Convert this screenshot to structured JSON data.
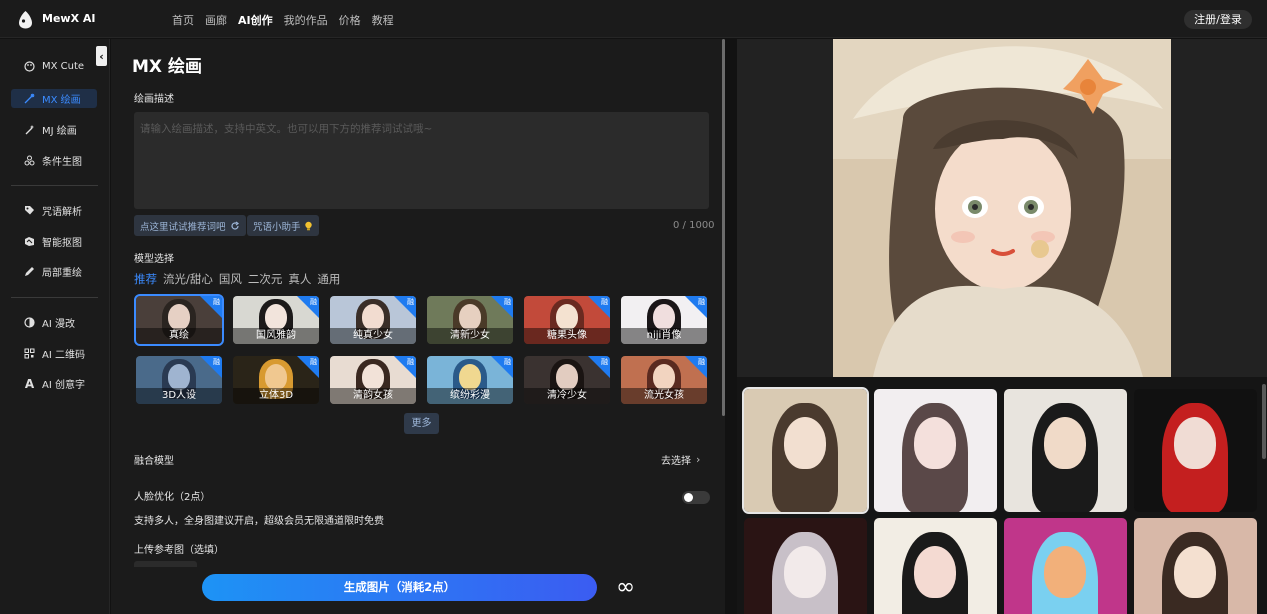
{
  "topbar": {
    "brand": "MewX AI",
    "nav": [
      "首页",
      "画廊",
      "AI创作",
      "我的作品",
      "价格",
      "教程"
    ],
    "active_nav": "AI创作",
    "login": "注册/登录"
  },
  "sidebar": {
    "items": [
      {
        "label": "MX Cute",
        "icon": "palette-icon"
      },
      {
        "label": "MX 绘画",
        "icon": "brush-icon",
        "active": true
      },
      {
        "label": "MJ 绘画",
        "icon": "wand-icon"
      },
      {
        "label": "条件生图",
        "icon": "nodes-icon"
      },
      {
        "label": "咒语解析",
        "icon": "tag-icon"
      },
      {
        "label": "智能抠图",
        "icon": "cutout-icon"
      },
      {
        "label": "局部重绘",
        "icon": "pen-icon"
      },
      {
        "label": "AI 漫改",
        "icon": "contrast-icon"
      },
      {
        "label": "AI 二维码",
        "icon": "qrcode-icon"
      },
      {
        "label": "AI 创意字",
        "icon": "letter-a-icon"
      }
    ]
  },
  "main": {
    "title": "MX 绘画",
    "desc_label": "绘画描述",
    "desc_placeholder": "请输入绘画描述，支持中英文。也可以用下方的推荐词试试哦~",
    "try_words": "点这里试试推荐词吧",
    "spell_helper": "咒语小助手",
    "counter": "0 / 1000",
    "model_label": "模型选择",
    "tabs": [
      "推荐",
      "流光/甜心",
      "国风",
      "二次元",
      "真人",
      "通用"
    ],
    "active_tab": "推荐",
    "badge": "融",
    "models": [
      {
        "label": "真绘",
        "colors": [
          "#4a3f3a",
          "#e6d0c4",
          "#2a2420"
        ]
      },
      {
        "label": "国风雅韵",
        "colors": [
          "#d8d8d2",
          "#f2e4dc",
          "#1c1a1a"
        ]
      },
      {
        "label": "纯真少女",
        "colors": [
          "#b9c6d8",
          "#f2dcd0",
          "#3a2e28"
        ]
      },
      {
        "label": "清新少女",
        "colors": [
          "#6f7a5a",
          "#e6d0c0",
          "#4a3a28"
        ]
      },
      {
        "label": "糖果头像",
        "colors": [
          "#c24a3a",
          "#f4e2d0",
          "#6a2a20"
        ]
      },
      {
        "label": "niji肖像",
        "colors": [
          "#f2f0f2",
          "#f0dede",
          "#1a1618"
        ]
      },
      {
        "label": "3D人设",
        "colors": [
          "#4a6a8a",
          "#9fb4d0",
          "#2a3a52"
        ]
      },
      {
        "label": "立体3D",
        "colors": [
          "#2a2418",
          "#f0c890",
          "#d89a30"
        ]
      },
      {
        "label": "清韵女孩",
        "colors": [
          "#e8dcd2",
          "#f2e2d8",
          "#3a2820"
        ]
      },
      {
        "label": "缤纷彩漫",
        "colors": [
          "#7ab4d8",
          "#f0d890",
          "#2a5a8a"
        ]
      },
      {
        "label": "清冷少女",
        "colors": [
          "#3a3230",
          "#e2ccc0",
          "#1a1412"
        ]
      },
      {
        "label": "流光女孩",
        "colors": [
          "#c07050",
          "#f2d4c0",
          "#5a2a20"
        ]
      }
    ],
    "more": "更多",
    "fusion_label": "融合模型",
    "fusion_action": "去选择",
    "face_label": "人脸优化（2点）",
    "face_desc": "支持多人，全身图建议开启，超级会员无限通道限时免费",
    "upload_label": "上传参考图（选填）",
    "generate": "生成图片（消耗2点）"
  },
  "gallery": {
    "thumbs": [
      {
        "colors": [
          "#d9cab3",
          "#f2dfd0",
          "#4a3a2e"
        ]
      },
      {
        "colors": [
          "#f2eef0",
          "#f4e0dc",
          "#5a4848"
        ]
      },
      {
        "colors": [
          "#e8e4de",
          "#f0dac8",
          "#1a1a1a"
        ]
      },
      {
        "colors": [
          "#111111",
          "#f0dcd4",
          "#c41f1f"
        ]
      },
      {
        "colors": [
          "#2a1414",
          "#f2eaea",
          "#c8c0c8"
        ]
      },
      {
        "colors": [
          "#f2ede4",
          "#f4dad2",
          "#1a1a1a"
        ]
      },
      {
        "colors": [
          "#c0368a",
          "#f2b07a",
          "#7ad0f0"
        ]
      },
      {
        "colors": [
          "#d8b8a8",
          "#f4e0d0",
          "#3a2a22"
        ]
      }
    ]
  }
}
